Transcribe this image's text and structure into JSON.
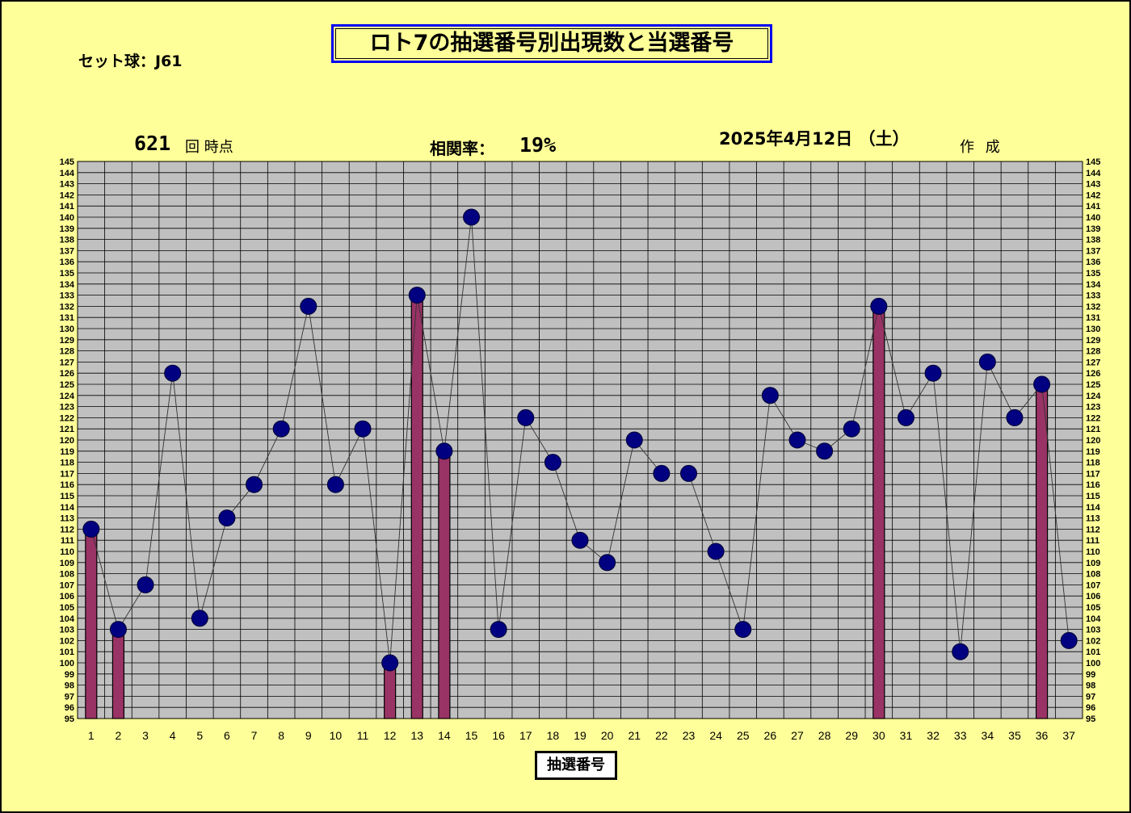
{
  "title": "ロト7の抽選番号別出現数と当選番号",
  "set_ball": "セット球：J61",
  "draw_number": "621",
  "draw_suffix": "回 時点",
  "correlation_label": "相関率：",
  "correlation_value": "19%",
  "date": "2025年4月12日 （土）",
  "made_label": "作 成",
  "chart_data": {
    "type": "bar",
    "xlabel": "抽選番号",
    "ylabel": "",
    "ylim": [
      95,
      145
    ],
    "grid": true,
    "categories": [
      "1",
      "2",
      "3",
      "4",
      "5",
      "6",
      "7",
      "8",
      "9",
      "10",
      "11",
      "12",
      "13",
      "14",
      "15",
      "16",
      "17",
      "18",
      "19",
      "20",
      "21",
      "22",
      "23",
      "24",
      "25",
      "26",
      "27",
      "28",
      "29",
      "30",
      "31",
      "32",
      "33",
      "34",
      "35",
      "36",
      "37"
    ],
    "series": [
      {
        "values": [
          112,
          103,
          107,
          126,
          104,
          113,
          116,
          121,
          132,
          116,
          121,
          100,
          133,
          119,
          140,
          103,
          122,
          118,
          111,
          109,
          120,
          117,
          117,
          110,
          103,
          124,
          120,
          119,
          121,
          132,
          122,
          126,
          101,
          127,
          122,
          125,
          102
        ],
        "marker": "circle",
        "line": true
      },
      {
        "winning_numbers": [
          "1",
          "2",
          "12",
          "13",
          "14",
          "30",
          "36"
        ]
      }
    ],
    "colors": {
      "marker": "#000080",
      "bar": "#993366",
      "plot_bg": "#c0c0c0",
      "grid": "#000000"
    }
  }
}
